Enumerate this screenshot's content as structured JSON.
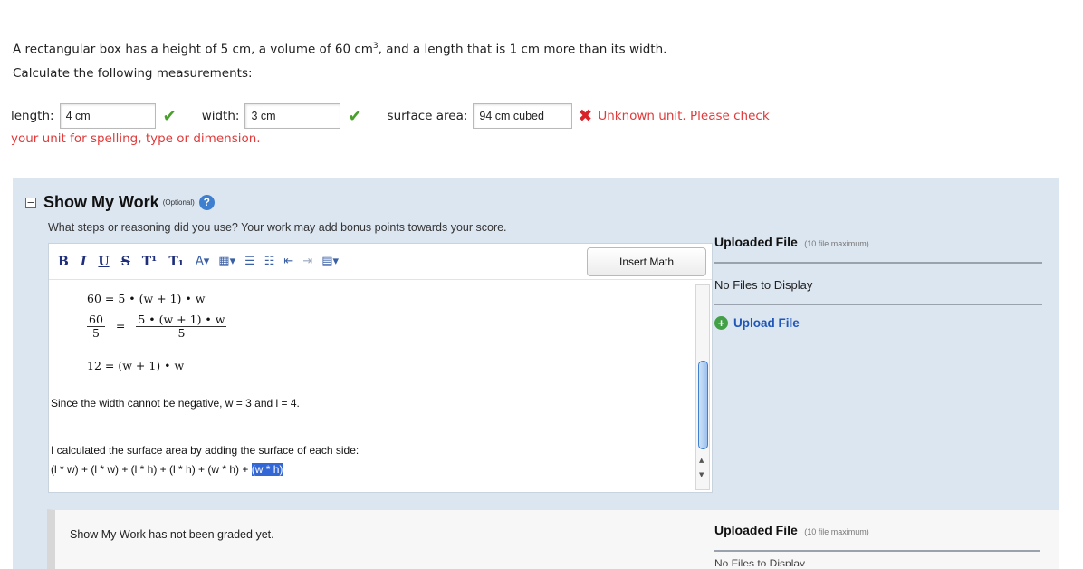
{
  "question": {
    "line1_pre": "A rectangular box has a height of 5 cm, a volume of 60 cm",
    "line1_sup": "3",
    "line1_post": ", and a length that is 1 cm more than its width.",
    "line2": "Calculate the following measurements:"
  },
  "answers": {
    "length_label": "length:",
    "length_value": "4 cm",
    "width_label": "width:",
    "width_value": "3 cm",
    "surface_label": "surface area:",
    "surface_value": "94 cm cubed",
    "error_line1": "Unknown unit. Please check",
    "error_line2": "your unit for spelling, type or dimension."
  },
  "work": {
    "collapse": "−",
    "title": "Show My Work",
    "optional": "(Optional)",
    "help": "?",
    "subtitle": "What steps or reasoning did you use? Your work may add bonus points towards your score.",
    "toolbar": {
      "bold": "B",
      "italic": "I",
      "underline": "U",
      "strike": "S",
      "sup": "T¹",
      "sub": "T₁",
      "insert_math": "Insert Math"
    },
    "editor": {
      "eq1": "60 = 5 • (w + 1) • w",
      "eq2_num_left": "60",
      "eq2_den_left": "5",
      "eq2_eq": "=",
      "eq2_num_right": "5 • (w + 1) • w",
      "eq2_den_right": "5",
      "eq3": "12 = (w + 1) • w",
      "text1": "Since the width cannot be negative, w = 3 and l = 4.",
      "text2": "I calculated the surface area by adding the surface of each side:",
      "text3": "(l * w) + (l * w) + (l * h) + (l * h) + (w * h) + ",
      "text3_highlight": "(w * h)"
    }
  },
  "uploaded": {
    "title": "Uploaded File",
    "max": "(10 file maximum)",
    "none": "No Files to Display",
    "upload_link": "Upload File"
  },
  "graded": {
    "text": "Show My Work has not been graded yet.",
    "upload_title": "Uploaded File",
    "upload_max": "(10 file maximum)",
    "cut_text": "No Files to Display"
  },
  "colors": {
    "panel_bg": "#dce6f1",
    "check": "#4aa02c",
    "error": "#e03a3a",
    "link": "#1f56b8"
  }
}
